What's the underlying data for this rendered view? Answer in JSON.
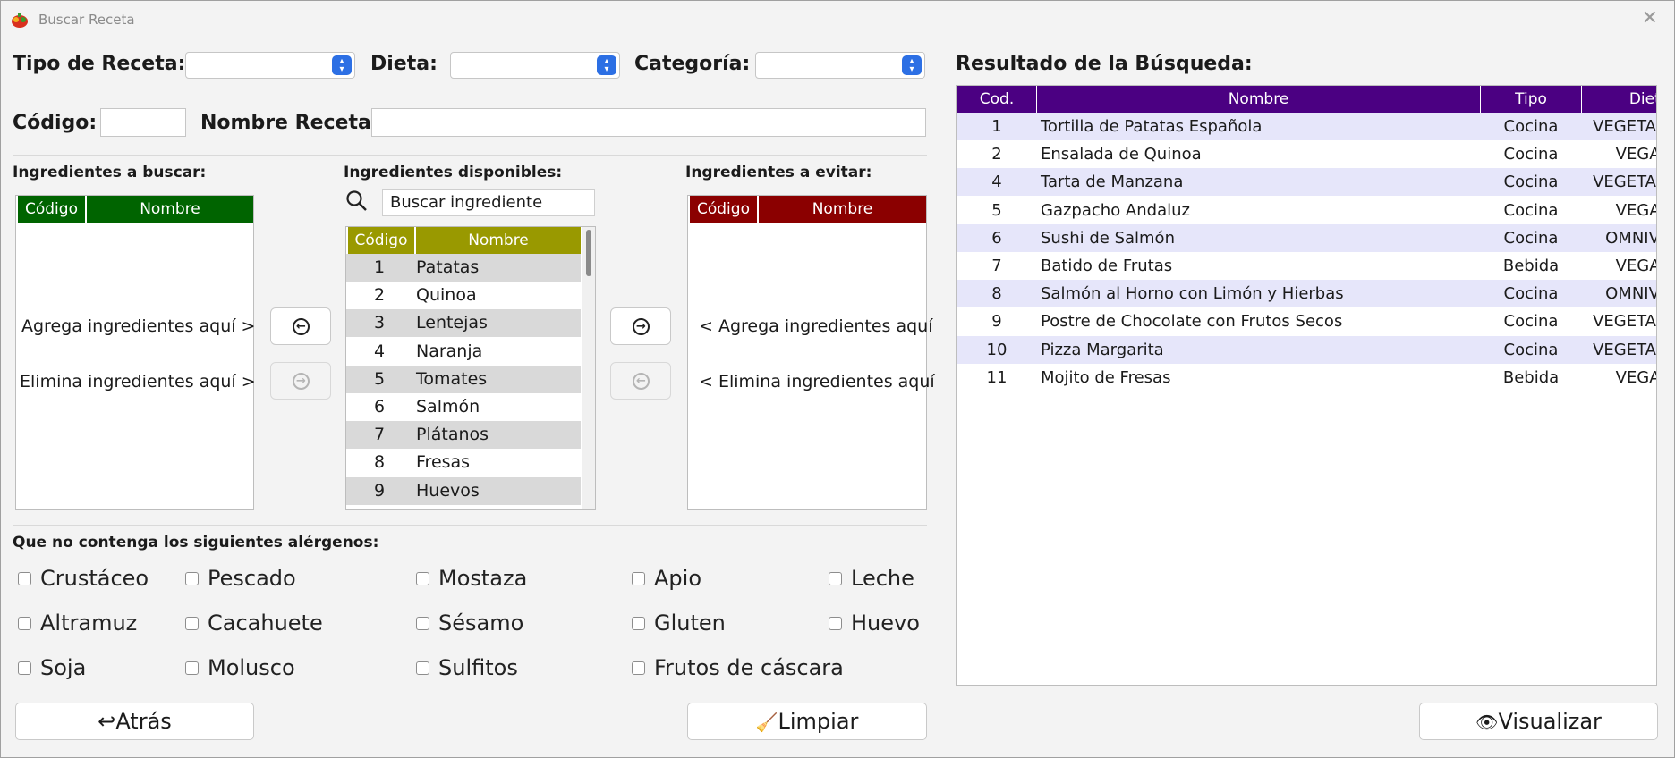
{
  "window": {
    "title": "Buscar Receta",
    "close_glyph": "✕"
  },
  "filters": {
    "tipo_label": "Tipo de Receta:",
    "dieta_label": "Dieta:",
    "categoria_label": "Categoría:",
    "codigo_label": "Código:",
    "nombre_label": "Nombre Receta:",
    "tipo_value": "",
    "dieta_value": "",
    "categoria_value": "",
    "codigo_value": "",
    "nombre_value": ""
  },
  "buscar_panel": {
    "title": "Ingredientes a buscar:",
    "col_codigo": "Código",
    "col_nombre": "Nombre",
    "hint_add": "Agrega ingredientes aquí >",
    "hint_remove": "Elimina ingredientes aquí >",
    "header_color": "#006400"
  },
  "disponibles_panel": {
    "title": "Ingredientes disponibles:",
    "search_value": "Buscar ingrediente",
    "col_codigo": "Código",
    "col_nombre": "Nombre",
    "header_color": "#999900",
    "rows": [
      {
        "codigo": "1",
        "nombre": "Patatas"
      },
      {
        "codigo": "2",
        "nombre": "Quinoa"
      },
      {
        "codigo": "3",
        "nombre": "Lentejas"
      },
      {
        "codigo": "4",
        "nombre": "Naranja"
      },
      {
        "codigo": "5",
        "nombre": "Tomates"
      },
      {
        "codigo": "6",
        "nombre": "Salmón"
      },
      {
        "codigo": "7",
        "nombre": "Plátanos"
      },
      {
        "codigo": "8",
        "nombre": "Fresas"
      },
      {
        "codigo": "9",
        "nombre": "Huevos"
      }
    ]
  },
  "evitar_panel": {
    "title": "Ingredientes a evitar:",
    "col_codigo": "Código",
    "col_nombre": "Nombre",
    "hint_add": "< Agrega ingredientes aquí",
    "hint_remove": "< Elimina ingredientes aquí",
    "header_color": "#8b0000"
  },
  "alergenos": {
    "title": "Que no contenga los siguientes alérgenos:",
    "items": [
      "Crustáceo",
      "Pescado",
      "Mostaza",
      "Apio",
      "Leche",
      "Altramuz",
      "Cacahuete",
      "Sésamo",
      "Gluten",
      "Huevo",
      "Soja",
      "Molusco",
      "Sulfitos",
      "Frutos de cáscara"
    ]
  },
  "buttons": {
    "atras": "Atrás",
    "limpiar": "Limpiar",
    "visualizar": "Visualizar"
  },
  "resultados": {
    "title": "Resultado de la Búsqueda:",
    "col_cod": "Cod.",
    "col_nombre": "Nombre",
    "col_tipo": "Tipo",
    "col_dieta": "Dieta",
    "header_color": "#4b0082",
    "rows": [
      {
        "cod": "1",
        "nombre": "Tortilla de Patatas Española",
        "tipo": "Cocina",
        "dieta": "VEGETARIANA"
      },
      {
        "cod": "2",
        "nombre": "Ensalada de Quinoa",
        "tipo": "Cocina",
        "dieta": "VEGANA"
      },
      {
        "cod": "4",
        "nombre": "Tarta de Manzana",
        "tipo": "Cocina",
        "dieta": "VEGETARIANA"
      },
      {
        "cod": "5",
        "nombre": "Gazpacho Andaluz",
        "tipo": "Cocina",
        "dieta": "VEGANA"
      },
      {
        "cod": "6",
        "nombre": "Sushi de Salmón",
        "tipo": "Cocina",
        "dieta": "OMNIVORA"
      },
      {
        "cod": "7",
        "nombre": "Batido de Frutas",
        "tipo": "Bebida",
        "dieta": "VEGANA"
      },
      {
        "cod": "8",
        "nombre": "Salmón al Horno con Limón y Hierbas",
        "tipo": "Cocina",
        "dieta": "OMNIVORA"
      },
      {
        "cod": "9",
        "nombre": "Postre de Chocolate con Frutos Secos",
        "tipo": "Cocina",
        "dieta": "VEGETARIANA"
      },
      {
        "cod": "10",
        "nombre": "Pizza Margarita",
        "tipo": "Cocina",
        "dieta": "VEGETARIANA"
      },
      {
        "cod": "11",
        "nombre": "Mojito de Fresas",
        "tipo": "Bebida",
        "dieta": "VEGANA"
      }
    ]
  }
}
